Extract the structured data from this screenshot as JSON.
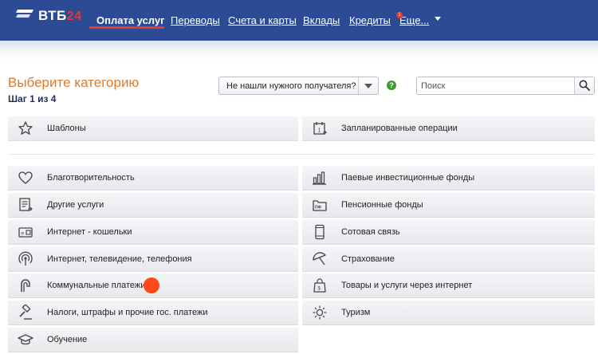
{
  "header": {
    "logo_text": "ВТБ",
    "logo_accent": "24",
    "nav": [
      {
        "label": "Оплата услуг",
        "active": true
      },
      {
        "label": "Переводы",
        "active": false
      },
      {
        "label": "Счета и карты",
        "active": false
      },
      {
        "label": "Вклады",
        "active": false
      },
      {
        "label": "Кредиты",
        "active": false
      },
      {
        "label": "Еще...",
        "active": false
      }
    ],
    "more_badge": "1",
    "colors": {
      "bar": "#2c4b94",
      "accent": "#e8382f"
    }
  },
  "main": {
    "title": "Выберите категорию",
    "step": "Шаг 1 из 4",
    "recipient_select": {
      "value": "Не нашли нужного получателя?"
    },
    "help_icon": "help-icon",
    "search": {
      "placeholder": "Поиск",
      "value": ""
    },
    "title_color": "#e0792b"
  },
  "top_categories": [
    {
      "label": "Шаблоны",
      "icon": "star-icon"
    },
    {
      "label": "Запланированные операции",
      "icon": "calendar-icon"
    }
  ],
  "categories": [
    {
      "label": "Благотворительность",
      "icon": "heart-icon"
    },
    {
      "label": "Паевые инвестиционные фонды",
      "icon": "bar-chart-icon"
    },
    {
      "label": "Другие услуги",
      "icon": "document-icon"
    },
    {
      "label": "Пенсионные фонды",
      "icon": "pension-fund-icon"
    },
    {
      "label": "Интернет - кошельки",
      "icon": "wallet-icon"
    },
    {
      "label": "Сотовая связь",
      "icon": "mobile-phone-icon"
    },
    {
      "label": "Интернет, телевидение, телефония",
      "icon": "broadcast-icon"
    },
    {
      "label": "Страхование",
      "icon": "umbrella-icon"
    },
    {
      "label": "Коммунальные платежи",
      "icon": "faucet-icon"
    },
    {
      "label": "Товары и услуги через интернет",
      "icon": "shopping-bag-icon"
    },
    {
      "label": "Налоги, штрафы и прочие гос. платежи",
      "icon": "gavel-icon"
    },
    {
      "label": "Туризм",
      "icon": "sun-icon"
    },
    {
      "label": "Обучение",
      "icon": "graduation-cap-icon"
    }
  ]
}
